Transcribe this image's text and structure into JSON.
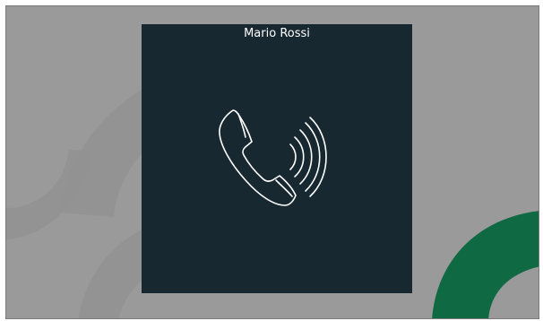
{
  "call": {
    "caller_name": "Mario Rossi",
    "icon": "phone-ringing-icon"
  },
  "colors": {
    "background": "#9a9a9a",
    "panel": "#172831",
    "accent_arc": "#0f6a44",
    "icon_stroke": "#ffffff"
  }
}
